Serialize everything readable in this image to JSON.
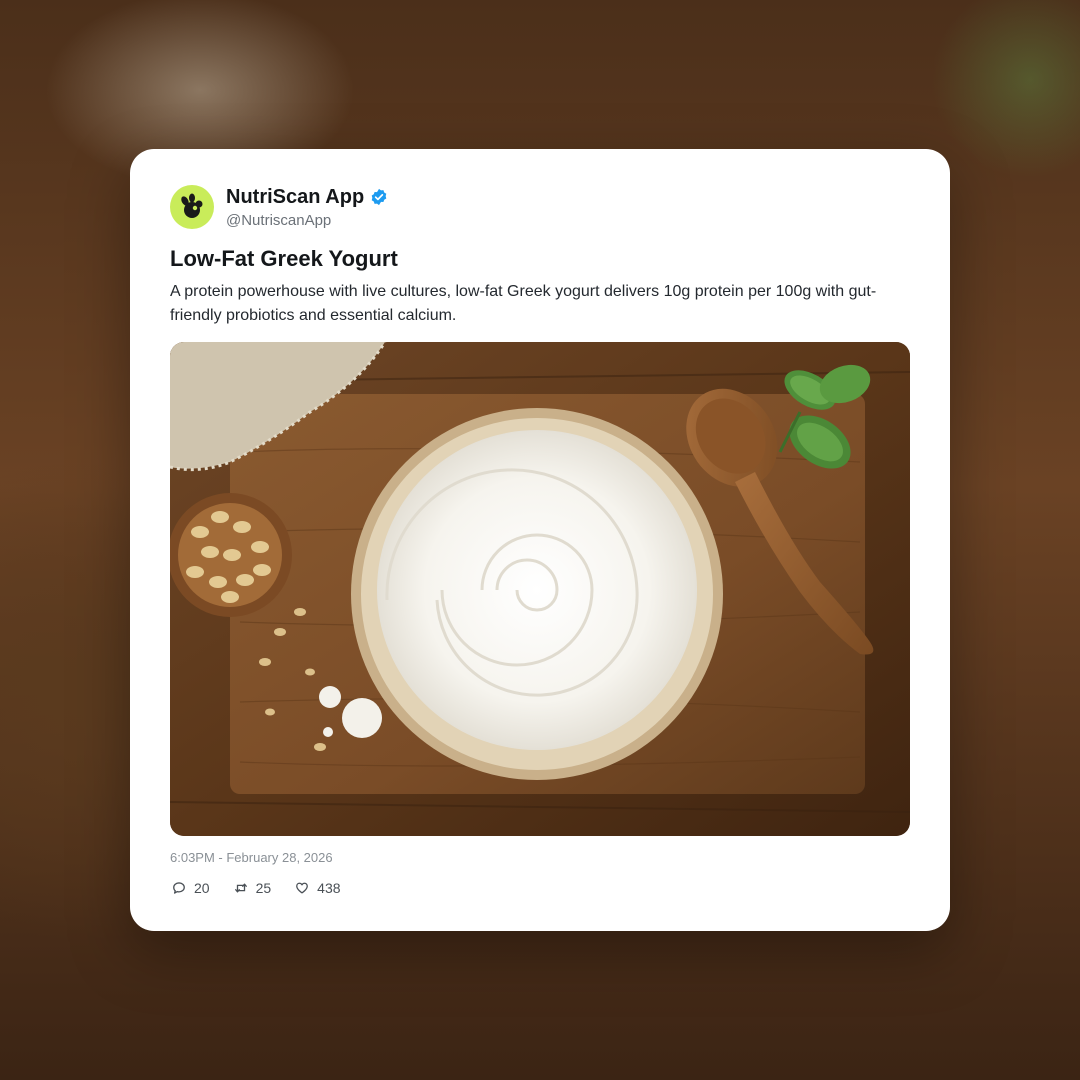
{
  "post": {
    "author_name": "NutriScan App",
    "author_handle": "@NutriscanApp",
    "title": "Low-Fat Greek Yogurt",
    "body": "A protein powerhouse with live cultures, low-fat Greek yogurt delivers 10g protein per 100g with gut-friendly probiotics and essential calcium.",
    "timestamp": "6:03PM - February 28, 2026",
    "stats": {
      "replies": "20",
      "reposts": "25",
      "likes": "438"
    }
  },
  "icons": {
    "avatar": "nutriscan-logo-icon",
    "verified": "verified-badge-icon",
    "reply": "reply-icon",
    "repost": "repost-icon",
    "like": "heart-icon"
  },
  "colors": {
    "avatar_bg": "#c9ec5a",
    "verified": "#1d9bf0",
    "card_bg": "#ffffff"
  }
}
